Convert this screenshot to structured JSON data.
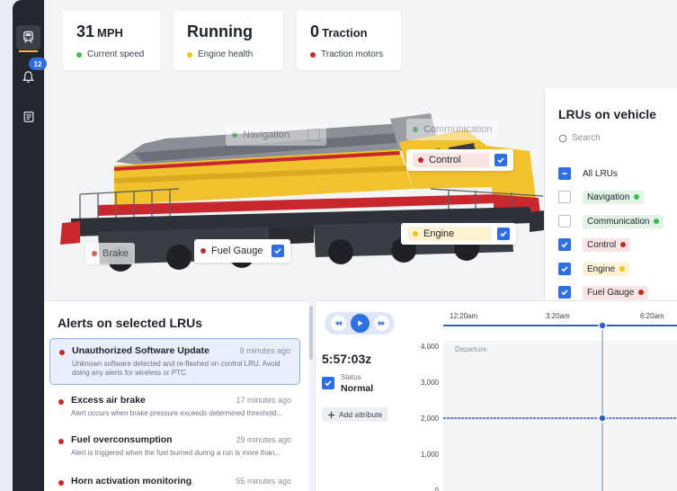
{
  "nav": {
    "notifications_count": "12"
  },
  "stats": [
    {
      "value": "31",
      "unit": "MPH",
      "label": "Current speed",
      "color": "#3cb85a"
    },
    {
      "value": "Running",
      "unit": "",
      "label": "Engine health",
      "color": "#f0c419"
    },
    {
      "value": "0",
      "unit": "Traction",
      "label": "Traction motors",
      "color": "#c62828"
    }
  ],
  "train_tags": {
    "navigation": "Navigation",
    "communication": "Communication",
    "control": "Control",
    "engine": "Engine",
    "fuel_gauge": "Fuel Gauge",
    "brake": "Brake"
  },
  "lru_panel": {
    "title": "LRUs on vehicle",
    "search_placeholder": "Search",
    "all_label": "All LRUs",
    "items": [
      {
        "label": "Navigation",
        "checked": false,
        "color": "#3cb85a",
        "bg": "#e3f4e7"
      },
      {
        "label": "Communication",
        "checked": false,
        "color": "#3cb85a",
        "bg": "#e3f4e7"
      },
      {
        "label": "Control",
        "checked": true,
        "color": "#c62828",
        "bg": "#fbe4e4"
      },
      {
        "label": "Engine",
        "checked": true,
        "color": "#f0c419",
        "bg": "#fcf3d4"
      },
      {
        "label": "Fuel Gauge",
        "checked": true,
        "color": "#c62828",
        "bg": "#fbe4e4"
      }
    ]
  },
  "alerts": {
    "title": "Alerts on selected LRUs",
    "items": [
      {
        "title": "Unauthorized Software Update",
        "time": "9 minutes ago",
        "desc": "Unknown software detected and re-flashed on control LRU. Avoid doing any alerts for wireless or PTC."
      },
      {
        "title": "Excess air brake",
        "time": "17 minutes ago",
        "desc": "Alert occurs when brake pressure exceeds determined threshold..."
      },
      {
        "title": "Fuel overconsumption",
        "time": "29 minutes ago",
        "desc": "Alert is triggered when the fuel burned during a run is more than..."
      },
      {
        "title": "Horn activation monitoring",
        "time": "55 minutes ago",
        "desc": ""
      }
    ]
  },
  "player": {
    "time": "5:57:03z",
    "status_key": "Status",
    "status_value": "Normal",
    "add_attribute": "Add attribute"
  },
  "chart_data": {
    "type": "line",
    "x_ticks": [
      "12:20am",
      "3:20am",
      "6:20am"
    ],
    "y_ticks": [
      4000,
      3000,
      2000,
      1000,
      0
    ],
    "annotation": "Departure",
    "series": [
      {
        "values": [
          2000,
          2000,
          2000
        ]
      }
    ],
    "ylim": [
      0,
      4000
    ]
  }
}
